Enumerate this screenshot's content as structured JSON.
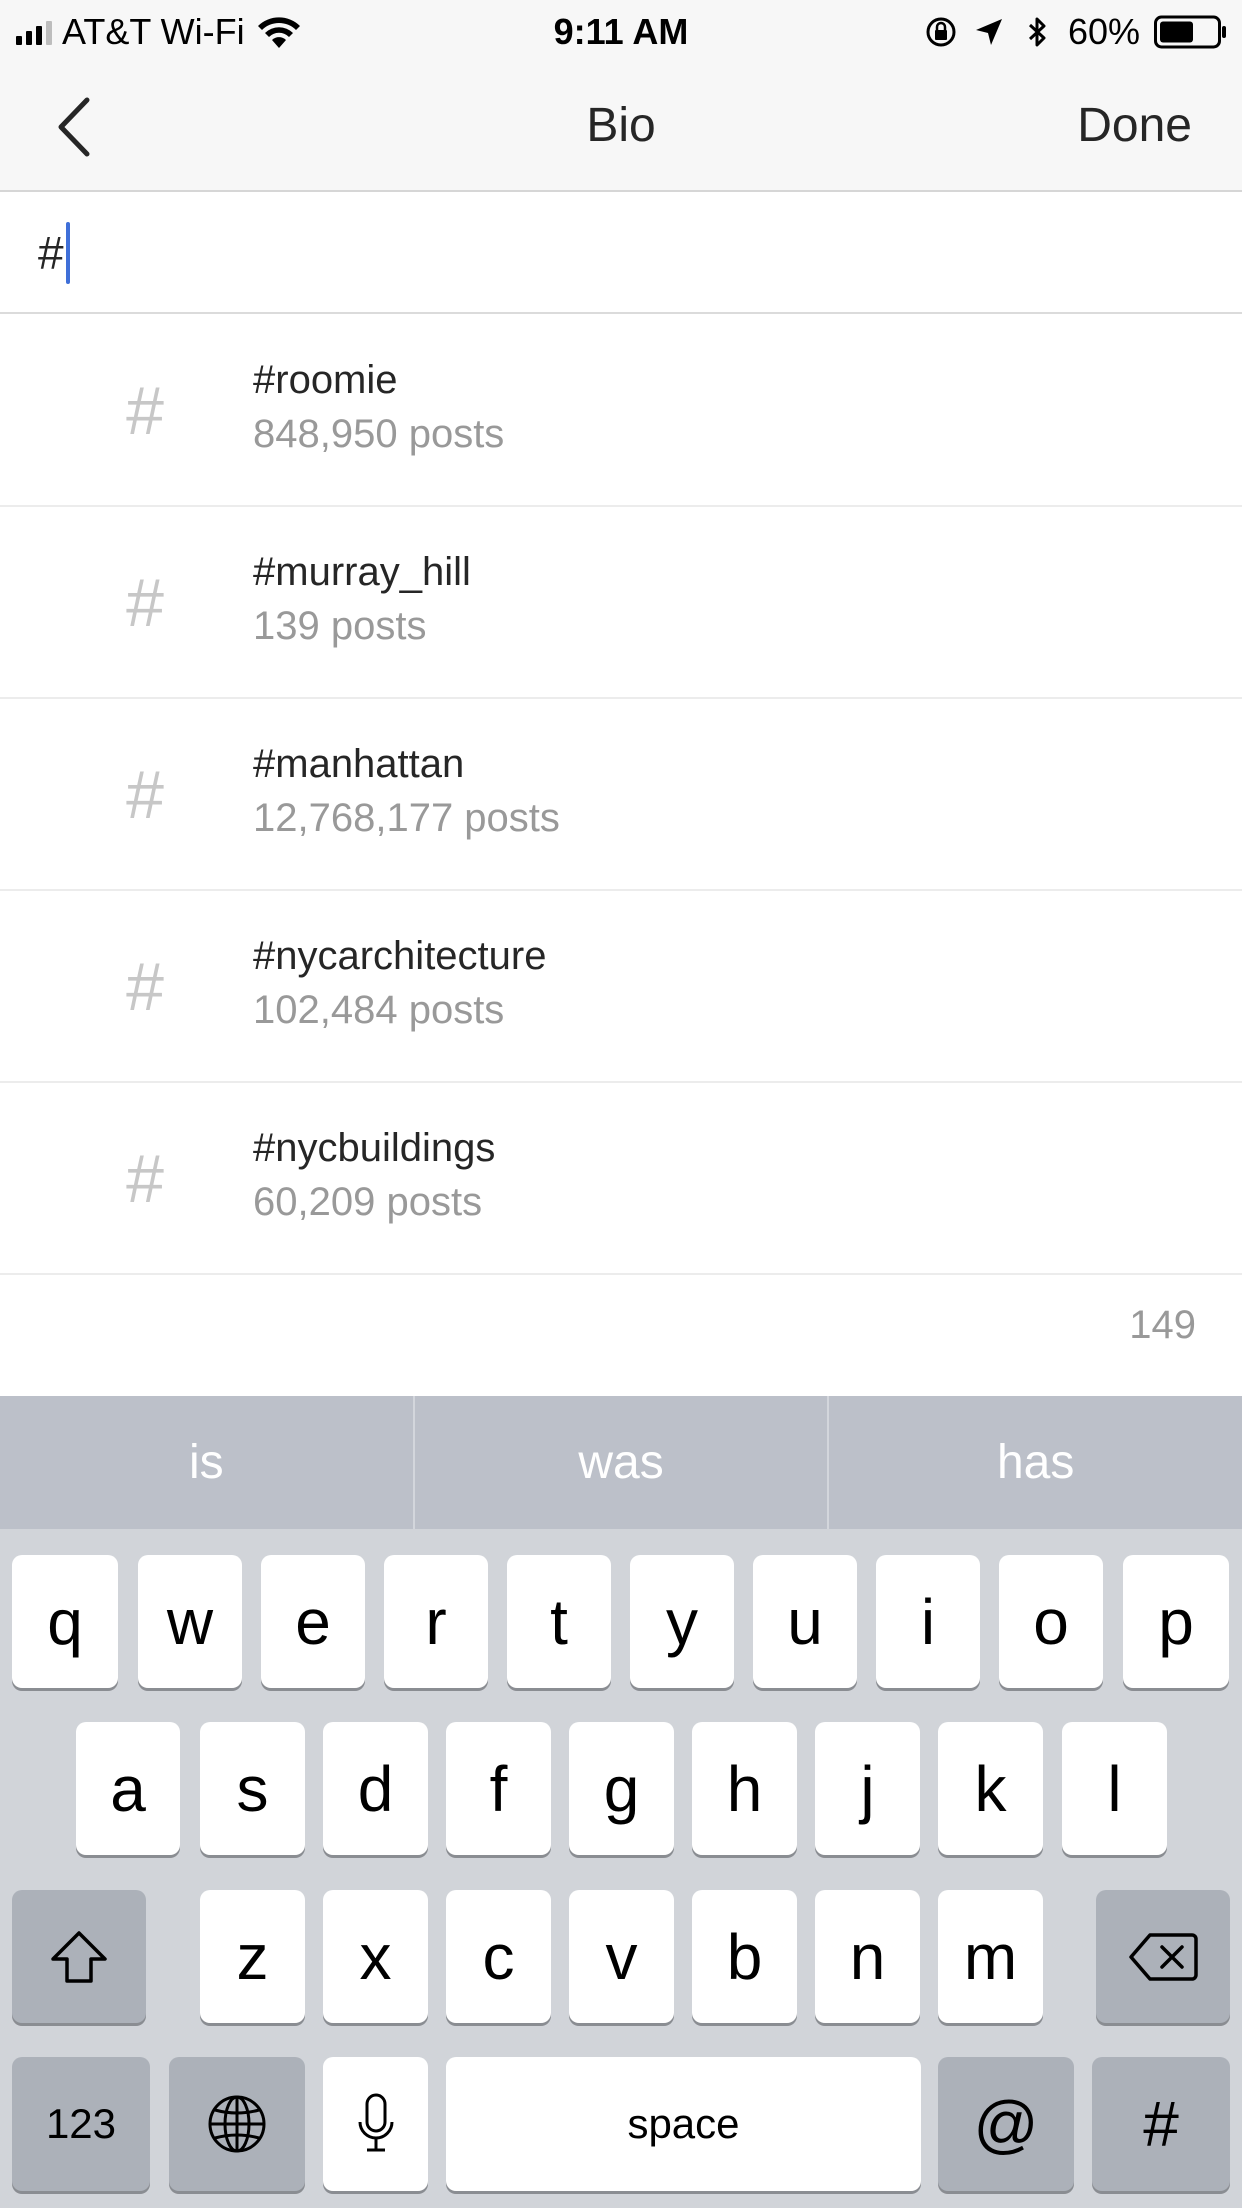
{
  "status_bar": {
    "carrier": "AT&T Wi-Fi",
    "time": "9:11 AM",
    "battery_percent": "60%",
    "battery_level": 0.6
  },
  "navbar": {
    "title": "Bio",
    "done_label": "Done"
  },
  "input": {
    "value": "#"
  },
  "suggestions": [
    {
      "tag": "#roomie",
      "count": "848,950 posts"
    },
    {
      "tag": "#murray_hill",
      "count": "139 posts"
    },
    {
      "tag": "#manhattan",
      "count": "12,768,177 posts"
    },
    {
      "tag": "#nycarchitecture",
      "count": "102,484 posts"
    },
    {
      "tag": "#nycbuildings",
      "count": "60,209 posts"
    }
  ],
  "suggestion_icon": "#",
  "char_remaining": "149",
  "keyboard": {
    "predictions": [
      "is",
      "was",
      "has"
    ],
    "row1": [
      "q",
      "w",
      "e",
      "r",
      "t",
      "y",
      "u",
      "i",
      "o",
      "p"
    ],
    "row2": [
      "a",
      "s",
      "d",
      "f",
      "g",
      "h",
      "j",
      "k",
      "l"
    ],
    "row3": [
      "z",
      "x",
      "c",
      "v",
      "b",
      "n",
      "m"
    ],
    "numbers_label": "123",
    "space_label": "space",
    "at_label": "@",
    "hash_label": "#"
  },
  "colors": {
    "caret": "#3f6fd8",
    "keyboard_bg": "#d1d4d9",
    "predictive_bg": "#bcc0c9"
  }
}
